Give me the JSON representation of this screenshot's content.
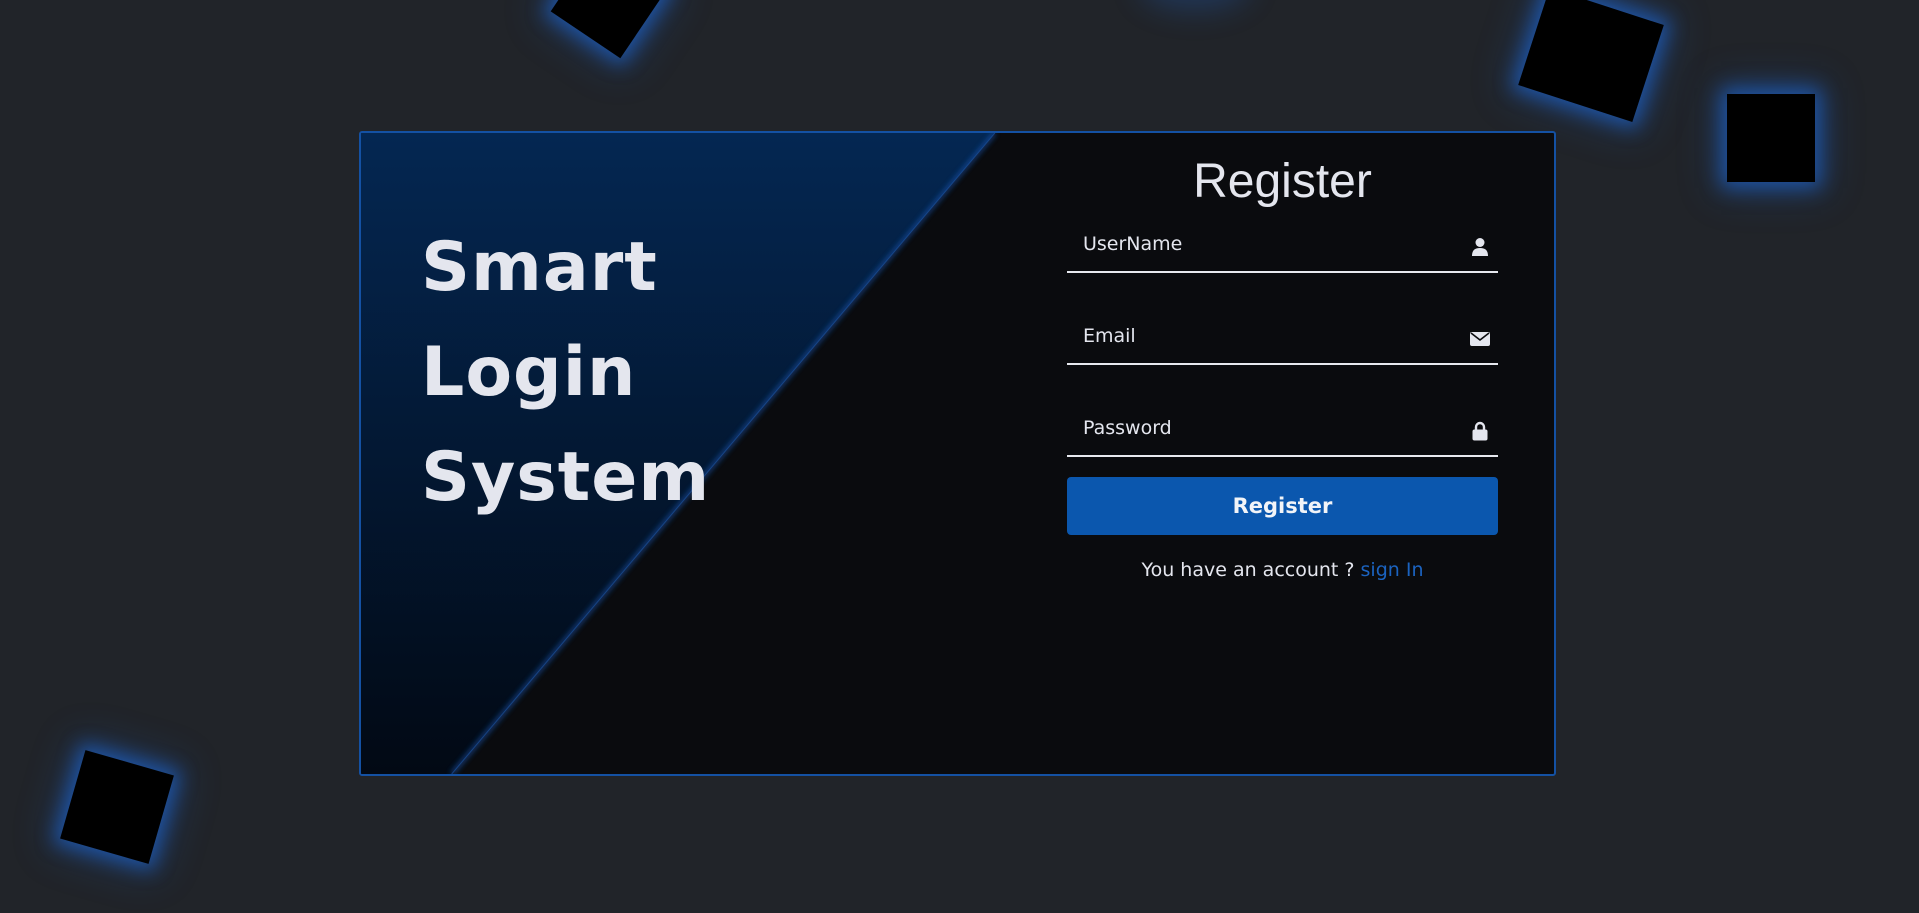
{
  "background": {
    "color": "#212429",
    "glow_color": "#1e6ee6",
    "square_color": "#000000"
  },
  "brand": {
    "lines": [
      "Smart",
      "Login",
      "System"
    ]
  },
  "form": {
    "title": "Register",
    "fields": {
      "username": {
        "placeholder": "UserName",
        "icon": "user-icon"
      },
      "email": {
        "placeholder": "Email",
        "icon": "envelope-icon"
      },
      "password": {
        "placeholder": "Password",
        "icon": "lock-icon"
      }
    },
    "submit_label": "Register",
    "account_prompt": "You have an account ?",
    "sign_in_link": "sign In"
  },
  "colors": {
    "accent": "#0b57ae",
    "link": "#1b63c0",
    "card_border": "#1451a3",
    "card_background": "#0a0b0e",
    "slant_gradient_top": "#042752",
    "slant_gradient_bottom": "#020914",
    "text": "#e4e6ee"
  }
}
